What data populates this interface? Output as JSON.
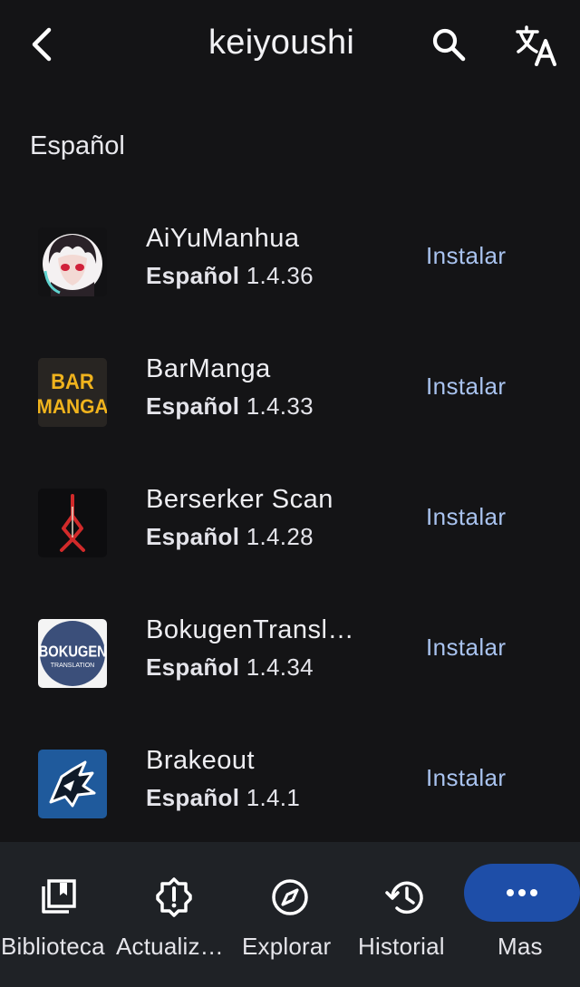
{
  "header": {
    "title": "keiyoushi",
    "back_icon": "arrow-back-icon",
    "search_icon": "search-icon",
    "translate_icon": "translate-icon"
  },
  "section": {
    "title": "Español"
  },
  "extensions": [
    {
      "name": "AiYuManhua",
      "language": "Español",
      "version": "1.4.36",
      "action": "Instalar",
      "logo": "anime-avatar"
    },
    {
      "name": "BarManga",
      "language": "Español",
      "version": "1.4.33",
      "action": "Instalar",
      "logo_text_1": "BAR",
      "logo_text_2": "MANGA"
    },
    {
      "name": "Berserker Scan",
      "language": "Español",
      "version": "1.4.28",
      "action": "Instalar",
      "logo": "brand-of-sacrifice"
    },
    {
      "name": "BokugenTransl…",
      "language": "Español",
      "version": "1.4.34",
      "action": "Instalar",
      "logo_text_1": "BOKUGEN",
      "logo_text_2": "TRANSLATION"
    },
    {
      "name": "Brakeout",
      "language": "Español",
      "version": "1.4.1",
      "action": "Instalar",
      "logo": "dragon-emblem"
    }
  ],
  "bottom_nav": {
    "items": [
      {
        "label": "Biblioteca",
        "icon": "library-icon"
      },
      {
        "label": "Actualiz…",
        "icon": "updates-icon"
      },
      {
        "label": "Explorar",
        "icon": "compass-icon"
      },
      {
        "label": "Historial",
        "icon": "history-icon"
      },
      {
        "label": "Mas",
        "icon": "more-icon",
        "active": true
      }
    ]
  },
  "colors": {
    "background": "#141416",
    "nav_background": "#1f2226",
    "accent_text": "#a9c3ef",
    "active_pill": "#1e4ea8"
  }
}
